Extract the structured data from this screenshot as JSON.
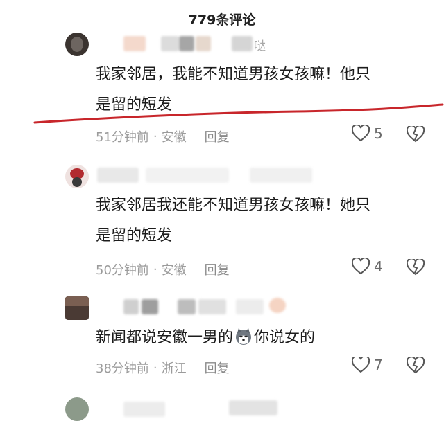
{
  "header": {
    "title": "779条评论"
  },
  "comments": [
    {
      "name_fragment": "哒",
      "text_line1": "我家邻居，我能不知道男孩女孩嘛！他只",
      "text_line2": "是留的短发",
      "time": "51分钟前",
      "location": "安徽",
      "reply_label": "回复",
      "likes": "5"
    },
    {
      "text_line1": "我家邻居我还能不知道男孩女孩嘛！她只",
      "text_line2": "是留的短发",
      "time": "50分钟前",
      "location": "安徽",
      "reply_label": "回复",
      "likes": "4"
    },
    {
      "text_before_emoji": "新闻都说安徽一男的",
      "text_after_emoji": "你说女的",
      "time": "38分钟前",
      "location": "浙江",
      "reply_label": "回复",
      "likes": "7"
    }
  ],
  "icons": {
    "like": "heart-outline-icon",
    "dislike": "broken-heart-icon",
    "emoji": "husky-dog-emoji-icon"
  },
  "colors": {
    "underline": "#c8262b",
    "meta_text": "#9b9b9b"
  }
}
